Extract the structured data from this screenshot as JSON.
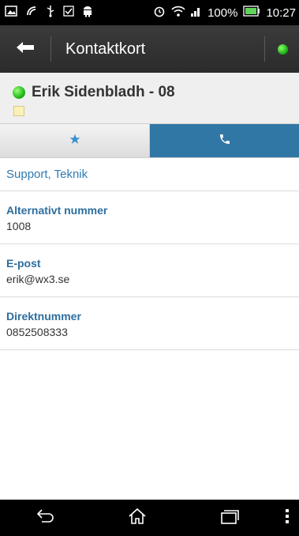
{
  "status_bar": {
    "battery_percent": "100%",
    "time": "10:27",
    "icons": [
      "gallery-icon",
      "usb-debug-icon",
      "usb-icon",
      "checkbox-icon",
      "android-icon",
      "alarm-icon",
      "wifi-icon",
      "signal-icon",
      "battery-icon"
    ]
  },
  "action_bar": {
    "title": "Kontaktkort"
  },
  "contact": {
    "name": "Erik Sidenbladh - 08",
    "presence_color": "#21b51a"
  },
  "tabs": [
    {
      "name": "favorites",
      "icon": "star-icon"
    },
    {
      "name": "phone",
      "icon": "phone-icon",
      "selected": true
    }
  ],
  "colors": {
    "accent": "#3177a6",
    "label": "#2c6e9e"
  },
  "section": {
    "title": "Support, Teknik"
  },
  "fields": [
    {
      "label": "Alternativt nummer",
      "value": "1008"
    },
    {
      "label": "E-post",
      "value": "erik@wx3.se"
    },
    {
      "label": "Direktnummer",
      "value": "0852508333"
    }
  ],
  "nav_bar": {
    "icons": [
      "back-icon",
      "home-icon",
      "recents-icon",
      "overflow-menu-icon"
    ]
  }
}
